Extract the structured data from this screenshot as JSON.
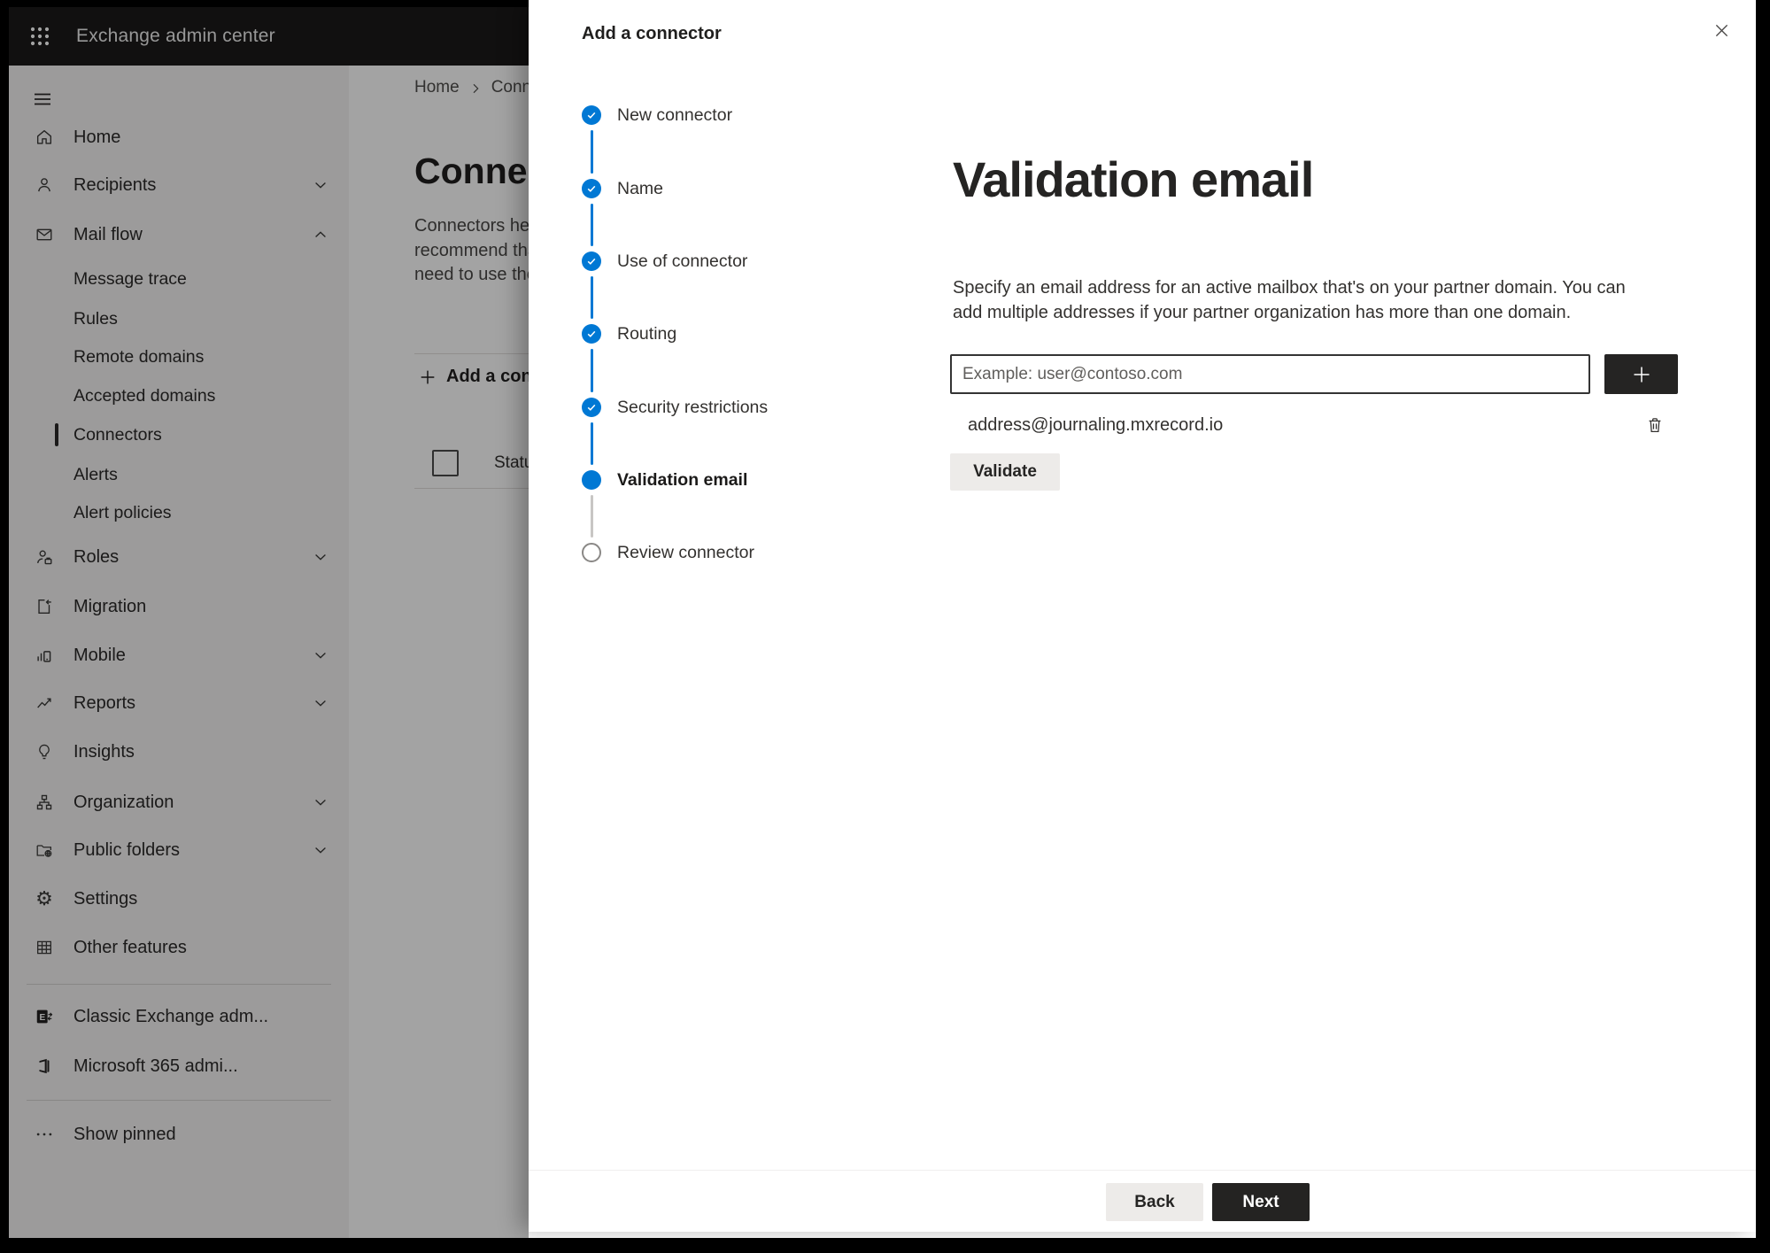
{
  "header": {
    "app_title": "Exchange admin center"
  },
  "sidebar": {
    "items": [
      {
        "label": "Home",
        "icon": "home-icon"
      },
      {
        "label": "Recipients",
        "icon": "person-icon",
        "chevron": "down"
      },
      {
        "label": "Mail flow",
        "icon": "mail-icon",
        "chevron": "up",
        "expanded": true
      },
      {
        "label": "Message trace",
        "sub": true
      },
      {
        "label": "Rules",
        "sub": true
      },
      {
        "label": "Remote domains",
        "sub": true
      },
      {
        "label": "Accepted domains",
        "sub": true
      },
      {
        "label": "Connectors",
        "sub": true,
        "selected": true
      },
      {
        "label": "Alerts",
        "sub": true
      },
      {
        "label": "Alert policies",
        "sub": true
      },
      {
        "label": "Roles",
        "icon": "person-roles-icon",
        "chevron": "down"
      },
      {
        "label": "Migration",
        "icon": "migration-icon"
      },
      {
        "label": "Mobile",
        "icon": "mobile-icon",
        "chevron": "down"
      },
      {
        "label": "Reports",
        "icon": "reports-icon",
        "chevron": "down"
      },
      {
        "label": "Insights",
        "icon": "lightbulb-icon"
      },
      {
        "label": "Organization",
        "icon": "org-icon",
        "chevron": "down"
      },
      {
        "label": "Public folders",
        "icon": "folder-globe-icon",
        "chevron": "down"
      },
      {
        "label": "Settings",
        "icon": "gear-icon"
      },
      {
        "label": "Other features",
        "icon": "table-icon"
      },
      {
        "label": "Classic Exchange adm...",
        "icon": "exchange-icon"
      },
      {
        "label": "Microsoft 365 admi...",
        "icon": "office-icon"
      },
      {
        "label": "Show pinned",
        "icon": "ellipsis-icon"
      }
    ]
  },
  "background_page": {
    "breadcrumb": [
      "Home",
      "Conne"
    ],
    "title": "Connec",
    "intro_lines": [
      "Connectors help",
      "recommend that",
      "need to use ther"
    ],
    "add_button": "Add a conn",
    "status_column": "Status"
  },
  "modal": {
    "title": "Add a connector",
    "steps": [
      {
        "label": "New connector",
        "state": "completed"
      },
      {
        "label": "Name",
        "state": "completed"
      },
      {
        "label": "Use of connector",
        "state": "completed"
      },
      {
        "label": "Routing",
        "state": "completed"
      },
      {
        "label": "Security restrictions",
        "state": "completed"
      },
      {
        "label": "Validation email",
        "state": "current"
      },
      {
        "label": "Review connector",
        "state": "upcoming"
      }
    ],
    "heading": "Validation email",
    "description": "Specify an email address for an active mailbox that's on your partner domain. You can add multiple addresses if your partner organization has more than one domain.",
    "email_input": {
      "value": "",
      "placeholder": "Example: user@contoso.com"
    },
    "added_addresses": [
      "address@journaling.mxrecord.io"
    ],
    "validate_button": "Validate",
    "back_button": "Back",
    "next_button": "Next"
  },
  "colors": {
    "accent": "#0078d4",
    "dark_button": "#252423",
    "light_button": "#edebe9",
    "topbar": "#1b1a19"
  }
}
